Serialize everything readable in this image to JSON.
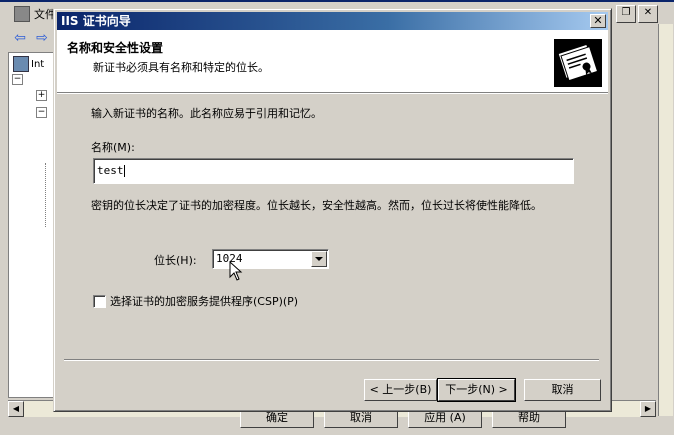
{
  "background": {
    "menu_label": "文件",
    "tree_root_label": "Int",
    "buttons": [
      "确定",
      "取消",
      "应用 (A)",
      "帮助"
    ]
  },
  "dialog": {
    "title": "IIS 证书向导",
    "close_glyph": "✕",
    "header": {
      "title": "名称和安全性设置",
      "subtitle": "新证书必须具有名称和特定的位长。"
    },
    "intro": "输入新证书的名称。此名称应易于引用和记忆。",
    "name_label": "名称(M):",
    "name_value": "test",
    "explain": "密钥的位长决定了证书的加密程度。位长越长，安全性越高。然而，位长过长将使性能降低。",
    "bit_label": "位长(H):",
    "bit_value": "1024",
    "csp_label": "选择证书的加密服务提供程序(CSP)(P)",
    "csp_checked": false,
    "buttons": {
      "back": "< 上一步(B)",
      "next": "下一步(N) >",
      "cancel": "取消"
    }
  },
  "colors": {
    "titlebar_start": "#0a246a",
    "titlebar_end": "#a6caf0",
    "face": "#d4d0c8"
  },
  "icons": [
    "back-arrow-icon",
    "forward-arrow-icon",
    "computer-icon",
    "certificate-icon",
    "mouse-cursor-icon"
  ]
}
